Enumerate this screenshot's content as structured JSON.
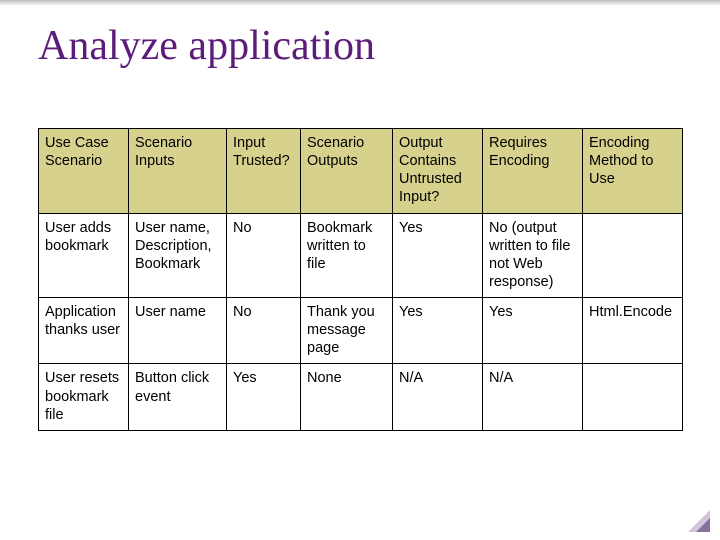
{
  "title": "Analyze application",
  "table": {
    "headers": [
      "Use Case Scenario",
      "Scenario Inputs",
      "Input Trusted?",
      "Scenario Outputs",
      "Output Contains Untrusted Input?",
      "Requires Encoding",
      "Encoding Method to Use"
    ],
    "rows": [
      {
        "use_case": "User adds bookmark",
        "inputs": "User name, Description, Bookmark",
        "trusted": "No",
        "outputs": "Bookmark written to file",
        "contains_untrusted": "Yes",
        "requires_encoding": "No (output written to file not Web response)",
        "method": ""
      },
      {
        "use_case": "Application thanks user",
        "inputs": "User name",
        "trusted": "No",
        "outputs": "Thank you message page",
        "contains_untrusted": "Yes",
        "requires_encoding": "Yes",
        "method": "Html.Encode"
      },
      {
        "use_case": "User resets bookmark file",
        "inputs": "Button click event",
        "trusted": "Yes",
        "outputs": "None",
        "contains_untrusted": "N/A",
        "requires_encoding": "N/A",
        "method": ""
      }
    ]
  },
  "chart_data": {
    "type": "table",
    "title": "Analyze application",
    "columns": [
      "Use Case Scenario",
      "Scenario Inputs",
      "Input Trusted?",
      "Scenario Outputs",
      "Output Contains Untrusted Input?",
      "Requires Encoding",
      "Encoding Method to Use"
    ],
    "rows": [
      [
        "User adds bookmark",
        "User name, Description, Bookmark",
        "No",
        "Bookmark written to file",
        "Yes",
        "No (output written to file not Web response)",
        ""
      ],
      [
        "Application thanks user",
        "User name",
        "No",
        "Thank you message page",
        "Yes",
        "Yes",
        "Html.Encode"
      ],
      [
        "User resets bookmark file",
        "Button click event",
        "Yes",
        "None",
        "N/A",
        "N/A",
        ""
      ]
    ]
  }
}
